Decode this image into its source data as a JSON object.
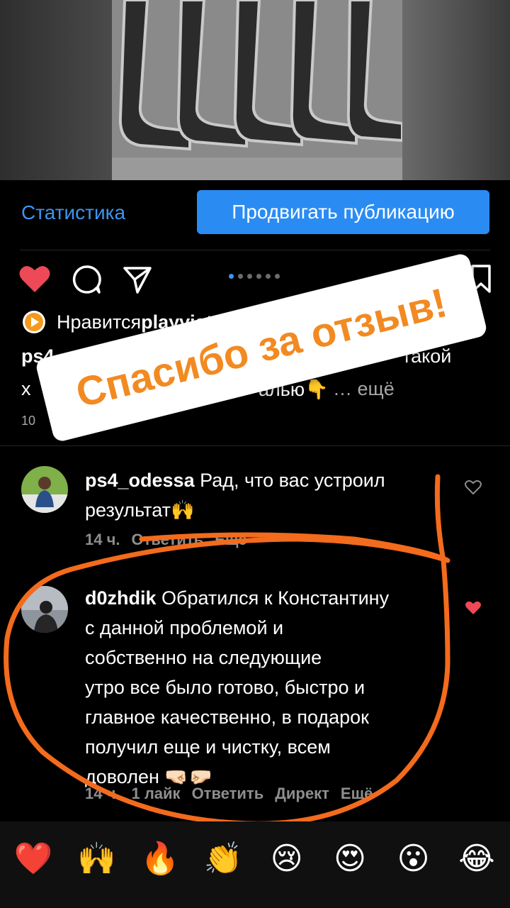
{
  "post": {
    "stat_link": "Статистика",
    "promote_button": "Продвигать публикацию",
    "liked_prefix": "Нравится ",
    "liked_user": "playviato",
    "caption_user": "ps4_odess",
    "caption_line1_end": "такой",
    "caption_line2_start": "х",
    "caption_line2_mid": "алью👇",
    "caption_more": "… ещё",
    "date_short": "10"
  },
  "sticker": {
    "text": "Спасибо за отзыв!"
  },
  "comments": [
    {
      "user": "ps4_odessa",
      "text_line1": "Рад, что вас устроил",
      "text_line2": "результат🙌",
      "time": "14 ч.",
      "reply": "Ответить",
      "more": "Ещё"
    },
    {
      "user": "d0zhdik",
      "text_line1": "Обратился к Константину",
      "text_line2": "с данной проблемой и",
      "text_line3": "собственно на следующие",
      "text_line4": "утро все было готово, быстро и",
      "text_line5": "главное качественно, в подарок",
      "text_line6": "получил еще и чистку, всем",
      "text_line7": "доволен 🤜🏻🤛🏻",
      "time": "14 ч.",
      "likes": "1 лайк",
      "reply": "Ответить",
      "direct": "Директ",
      "more": "Ещё"
    }
  ],
  "reactions": [
    "❤️",
    "🙌",
    "🔥",
    "👏",
    "😢",
    "😍",
    "😮",
    "😂"
  ],
  "colors": {
    "accent": "#3d95f0",
    "sticker_text": "#f28a22",
    "scribble": "#f36b1c",
    "heart": "#ed4956"
  }
}
